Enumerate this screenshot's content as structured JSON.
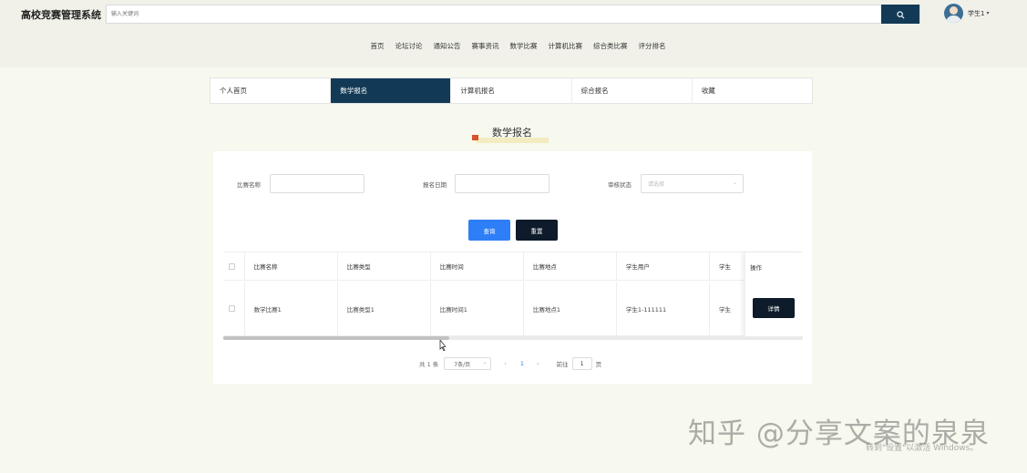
{
  "header": {
    "site_title": "高校竞赛管理系统",
    "search_placeholder": "输入关键词",
    "user_name": "学生1"
  },
  "nav": [
    "首页",
    "论坛讨论",
    "通知公告",
    "赛事资讯",
    "数学比赛",
    "计算机比赛",
    "综合类比赛",
    "评分排名"
  ],
  "tabs": [
    {
      "label": "个人首页",
      "active": false
    },
    {
      "label": "数学报名",
      "active": true
    },
    {
      "label": "计算机报名",
      "active": false
    },
    {
      "label": "综合报名",
      "active": false
    },
    {
      "label": "收藏",
      "active": false
    }
  ],
  "page_title": "数学报名",
  "filters": {
    "name_label": "比赛名称",
    "date_label": "报名日期",
    "status_label": "审核状态",
    "status_placeholder": "请选择"
  },
  "buttons": {
    "query": "查询",
    "reset": "重置",
    "detail": "详情"
  },
  "table": {
    "columns": [
      "比赛名称",
      "比赛类型",
      "比赛时间",
      "比赛地点",
      "学生用户",
      "学生"
    ],
    "action_header": "操作",
    "rows": [
      [
        "数学比赛1",
        "比赛类型1",
        "比赛时间1",
        "比赛地点1",
        "学生1-111111",
        "学生"
      ]
    ]
  },
  "pagination": {
    "total": "共 1 条",
    "page_size": "7条/页",
    "current": "1",
    "goto_label": "前往",
    "goto_value": "1",
    "page_suffix": "页"
  },
  "watermark": {
    "text": "知乎 @分享文案的泉泉",
    "windows": "转到\"设置\"以激活 Windows。"
  },
  "colors": {
    "primary_dark": "#123a56",
    "query_blue": "#2d7ef7",
    "reset_black": "#0d1b2a",
    "page_bg": "#f7f8ee"
  }
}
